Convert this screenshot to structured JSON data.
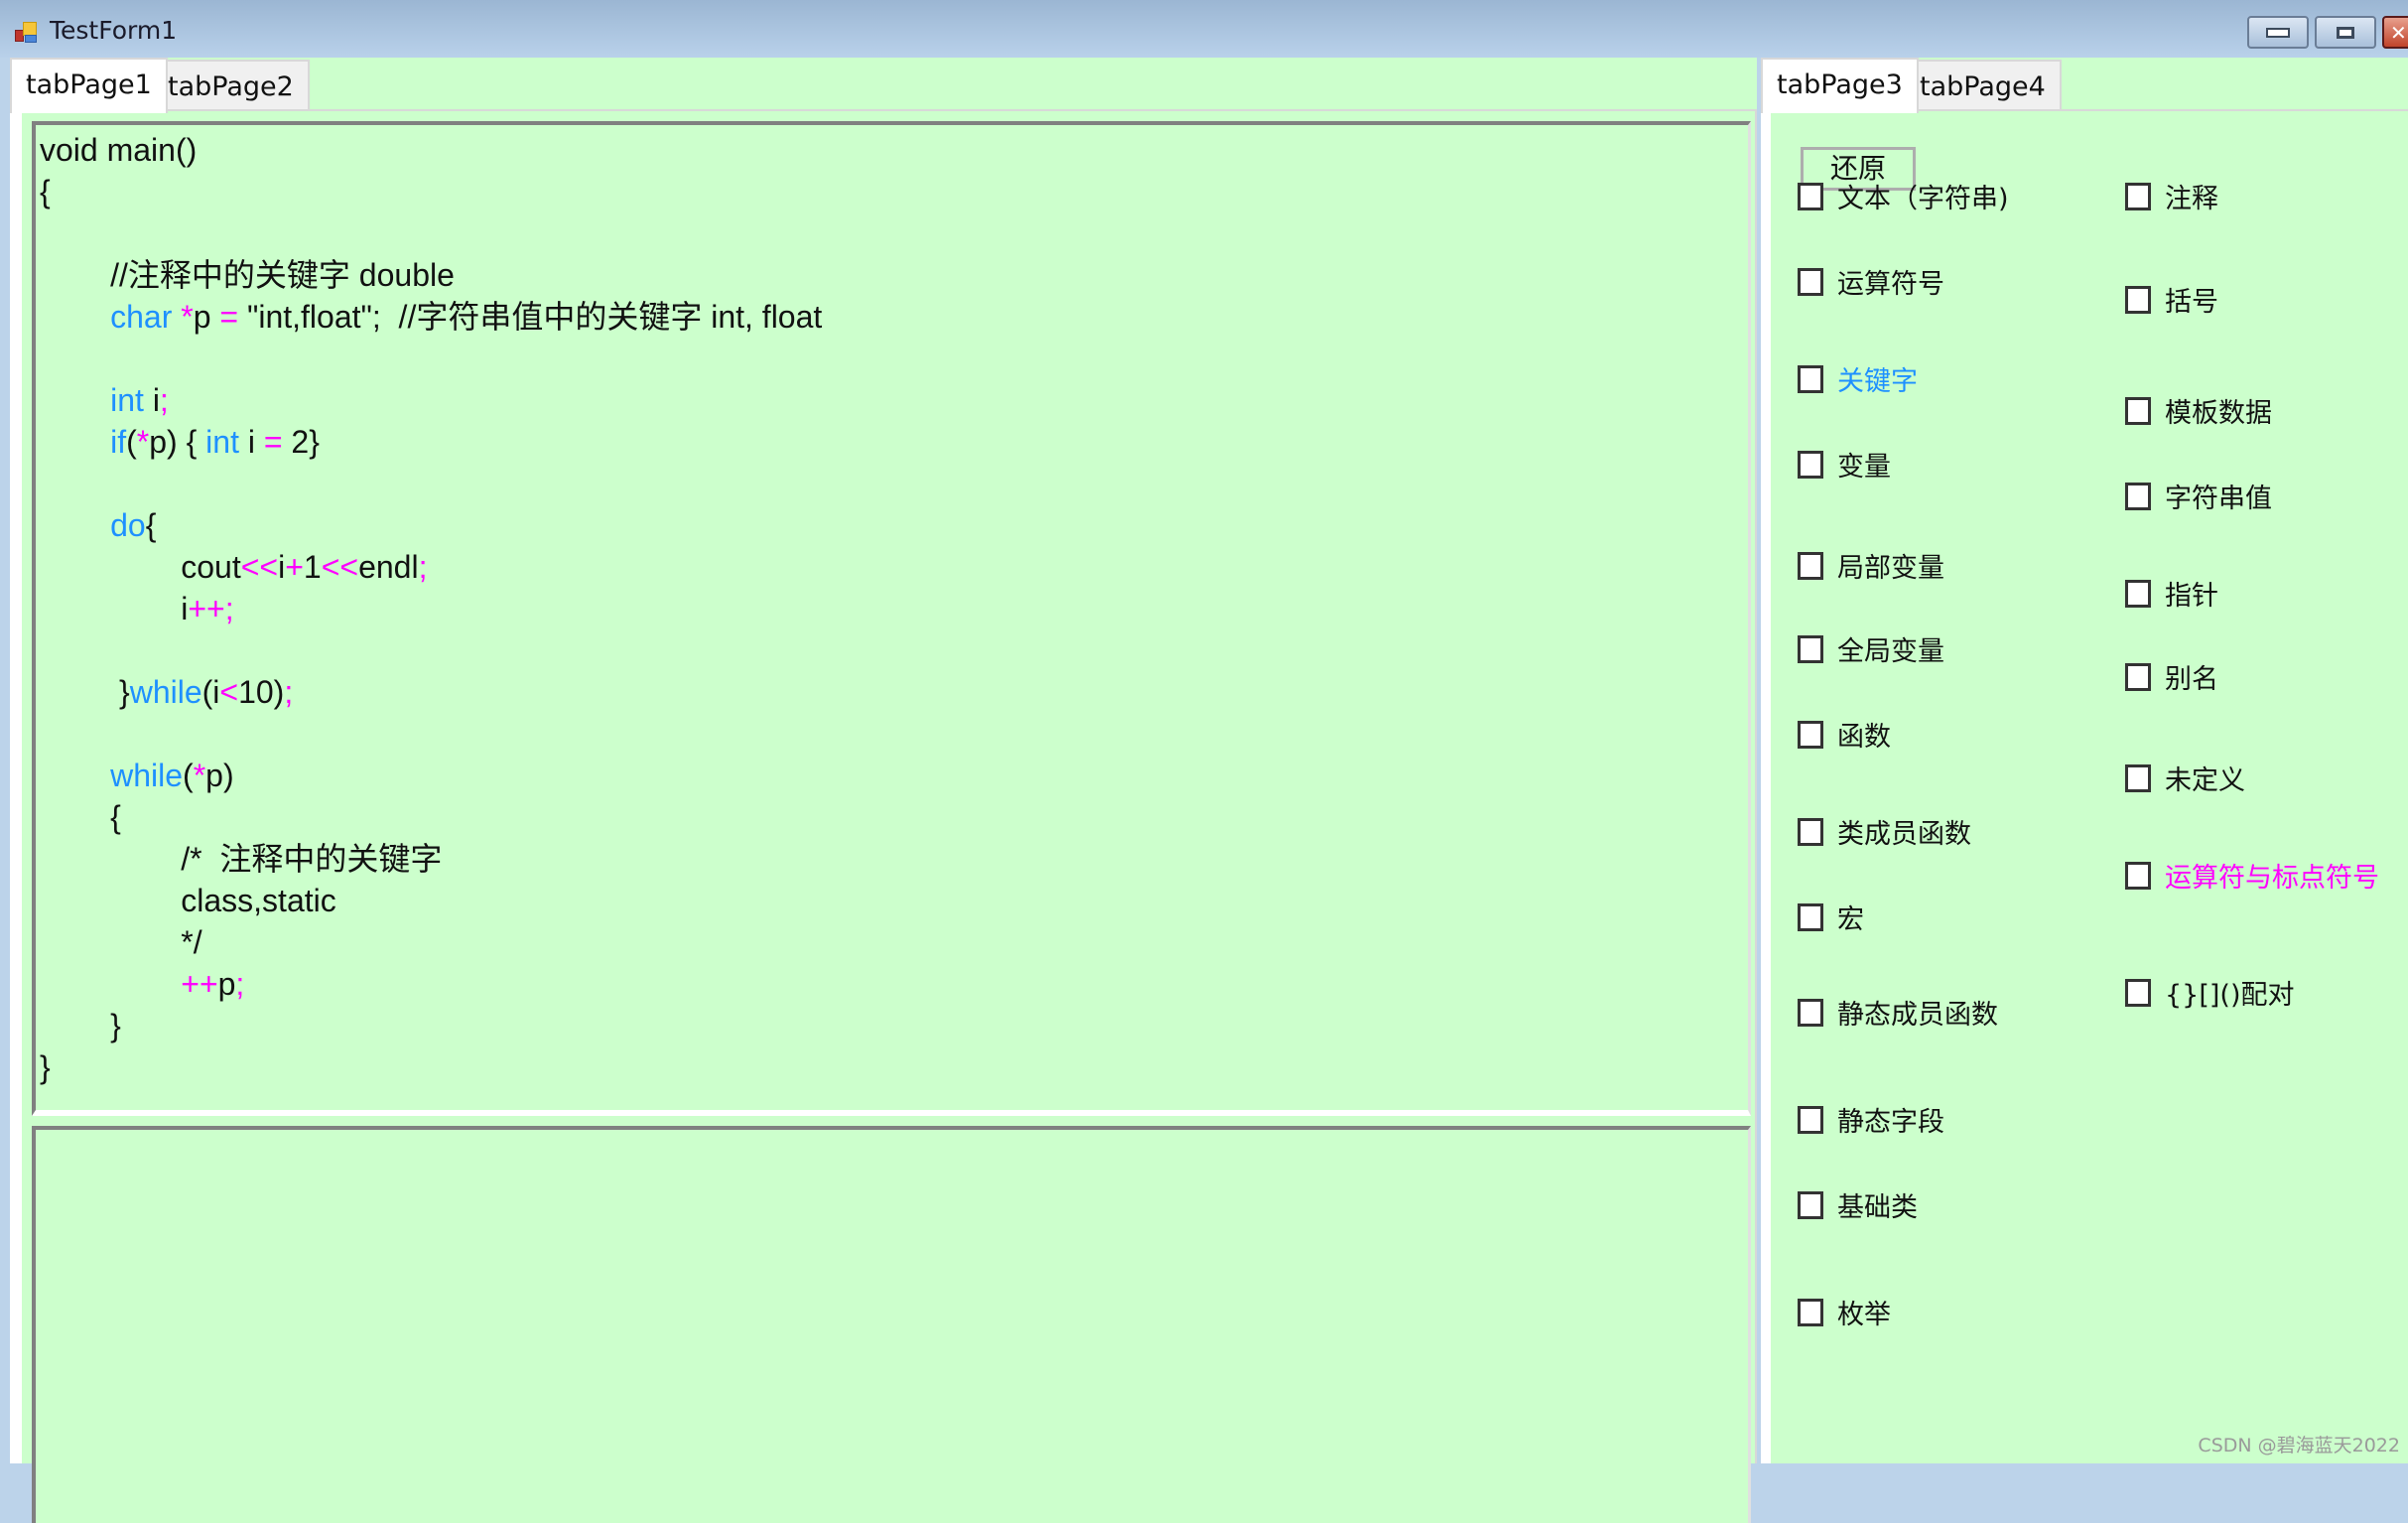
{
  "window": {
    "title": "TestForm1",
    "controls": {
      "minimize": "minimize",
      "maximize": "maximize",
      "close": "✕"
    }
  },
  "left_tabs": {
    "tabs": [
      {
        "label": "tabPage1",
        "active": true
      },
      {
        "label": "tabPage2",
        "active": false
      }
    ],
    "code_lines": [
      [
        {
          "t": "void main()",
          "c": "plain"
        }
      ],
      [
        {
          "t": "{",
          "c": "plain"
        }
      ],
      [],
      [
        {
          "t": "        //注释中的关键字 double",
          "c": "plain"
        }
      ],
      [
        {
          "t": "        ",
          "c": "plain"
        },
        {
          "t": "char",
          "c": "kw"
        },
        {
          "t": " ",
          "c": "plain"
        },
        {
          "t": "*",
          "c": "op"
        },
        {
          "t": "p ",
          "c": "plain"
        },
        {
          "t": "=",
          "c": "op"
        },
        {
          "t": " \"int,float\";  //字符串值中的关键字 int, float",
          "c": "plain"
        }
      ],
      [],
      [
        {
          "t": "        ",
          "c": "plain"
        },
        {
          "t": "int",
          "c": "kw"
        },
        {
          "t": " i",
          "c": "plain"
        },
        {
          "t": ";",
          "c": "op"
        }
      ],
      [
        {
          "t": "        ",
          "c": "plain"
        },
        {
          "t": "if",
          "c": "kw"
        },
        {
          "t": "(",
          "c": "plain"
        },
        {
          "t": "*",
          "c": "op"
        },
        {
          "t": "p) { ",
          "c": "plain"
        },
        {
          "t": "int",
          "c": "kw"
        },
        {
          "t": " i ",
          "c": "plain"
        },
        {
          "t": "=",
          "c": "op"
        },
        {
          "t": " 2}",
          "c": "plain"
        }
      ],
      [],
      [
        {
          "t": "        ",
          "c": "plain"
        },
        {
          "t": "do",
          "c": "kw"
        },
        {
          "t": "{",
          "c": "plain"
        }
      ],
      [
        {
          "t": "                cout",
          "c": "plain"
        },
        {
          "t": "<<",
          "c": "op"
        },
        {
          "t": "i",
          "c": "plain"
        },
        {
          "t": "+",
          "c": "op"
        },
        {
          "t": "1",
          "c": "plain"
        },
        {
          "t": "<<",
          "c": "op"
        },
        {
          "t": "endl",
          "c": "plain"
        },
        {
          "t": ";",
          "c": "op"
        }
      ],
      [
        {
          "t": "                i",
          "c": "plain"
        },
        {
          "t": "++;",
          "c": "op"
        }
      ],
      [],
      [
        {
          "t": "         }",
          "c": "plain"
        },
        {
          "t": "while",
          "c": "kw"
        },
        {
          "t": "(i",
          "c": "plain"
        },
        {
          "t": "<",
          "c": "op"
        },
        {
          "t": "10)",
          "c": "plain"
        },
        {
          "t": ";",
          "c": "op"
        }
      ],
      [],
      [
        {
          "t": "        ",
          "c": "plain"
        },
        {
          "t": "while",
          "c": "kw"
        },
        {
          "t": "(",
          "c": "plain"
        },
        {
          "t": "*",
          "c": "op"
        },
        {
          "t": "p)",
          "c": "plain"
        }
      ],
      [
        {
          "t": "        {",
          "c": "plain"
        }
      ],
      [
        {
          "t": "                /*  注释中的关键字",
          "c": "plain"
        }
      ],
      [
        {
          "t": "                class,static",
          "c": "plain"
        }
      ],
      [
        {
          "t": "                */",
          "c": "plain"
        }
      ],
      [
        {
          "t": "                ",
          "c": "plain"
        },
        {
          "t": "++",
          "c": "op"
        },
        {
          "t": "p",
          "c": "plain"
        },
        {
          "t": ";",
          "c": "op"
        }
      ],
      [
        {
          "t": "        }",
          "c": "plain"
        }
      ],
      [
        {
          "t": "}",
          "c": "plain"
        }
      ]
    ],
    "output_text": ""
  },
  "right_tabs": {
    "tabs": [
      {
        "label": "tabPage3",
        "active": true
      },
      {
        "label": "tabPage4",
        "active": false
      }
    ],
    "restore_button": "还原",
    "checkboxes_left": [
      {
        "label": "文本（字符串)",
        "checked": false,
        "color": "default"
      },
      {
        "label": "运算符号",
        "checked": false,
        "color": "default"
      },
      {
        "label": "关键字",
        "checked": false,
        "color": "blue"
      },
      {
        "label": " 变量",
        "checked": false,
        "color": "default"
      },
      {
        "label": "局部变量",
        "checked": false,
        "color": "default"
      },
      {
        "label": "全局变量",
        "checked": false,
        "color": "default"
      },
      {
        "label": "函数",
        "checked": false,
        "color": "default"
      },
      {
        "label": "类成员函数",
        "checked": false,
        "color": "default"
      },
      {
        "label": "宏",
        "checked": false,
        "color": "default"
      },
      {
        "label": "静态成员函数",
        "checked": false,
        "color": "default"
      },
      {
        "label": "静态字段",
        "checked": false,
        "color": "default"
      },
      {
        "label": "基础类",
        "checked": false,
        "color": "default"
      },
      {
        "label": "枚举",
        "checked": false,
        "color": "default"
      }
    ],
    "checkboxes_right": [
      {
        "label": "注释",
        "checked": false,
        "color": "default"
      },
      {
        "label": "括号",
        "checked": false,
        "color": "default"
      },
      {
        "label": "模板数据",
        "checked": false,
        "color": "default"
      },
      {
        "label": "字符串值",
        "checked": false,
        "color": "default"
      },
      {
        "label": "指针",
        "checked": false,
        "color": "default"
      },
      {
        "label": "别名",
        "checked": false,
        "color": "default"
      },
      {
        "label": "未定义",
        "checked": false,
        "color": "default"
      },
      {
        "label": "运算符与标点符号",
        "checked": false,
        "color": "magenta"
      },
      {
        "label": "{}[]()配对",
        "checked": false,
        "color": "default"
      }
    ]
  },
  "colors": {
    "background": "#ccffcc",
    "keyword": "#1e90ff",
    "operator": "#ff00ff"
  },
  "watermark": "CSDN @碧海蓝天2022"
}
